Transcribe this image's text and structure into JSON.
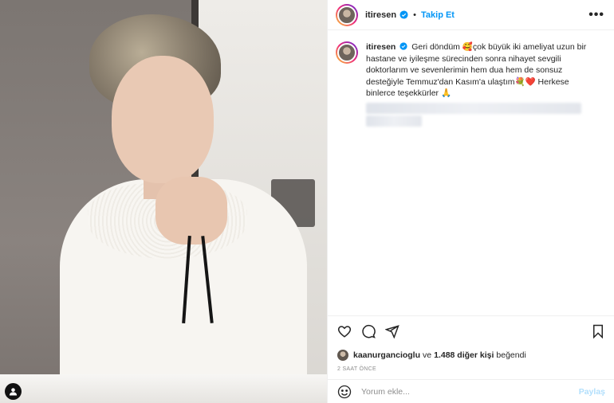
{
  "post": {
    "username": "itiresen",
    "separator": "•",
    "follow_label": "Takip Et",
    "more_label": "•••",
    "caption_username": "itiresen",
    "caption_text": "Geri döndüm 🥰çok büyük iki ameliyat uzun bir hastane ve iyileşme sürecinden sonra nihayet sevgili doktorlarım ve sevenlerimin hem dua hem de sonsuz desteğiyle Temmuz'dan Kasım'a ulaştım💐❤️ Herkese binlerce teşekkürler 🙏",
    "likes_user": "kaanurgancioglu",
    "likes_connector": "ve",
    "likes_others": "1.488 diğer kişi",
    "likes_suffix": "beğendi",
    "timestamp": "2 SAAT ÖNCE",
    "comment_placeholder": "Yorum ekle...",
    "post_button": "Paylaş"
  },
  "icons": {
    "verified": "verified-badge-icon",
    "like": "heart-icon",
    "comment": "comment-icon",
    "share": "share-icon",
    "save": "bookmark-icon",
    "emoji": "smiley-icon",
    "tag": "user-tag-icon"
  },
  "colors": {
    "accent": "#0095f6",
    "text": "#262626",
    "muted": "#8e8e8e",
    "post_disabled": "#b2dffc"
  }
}
